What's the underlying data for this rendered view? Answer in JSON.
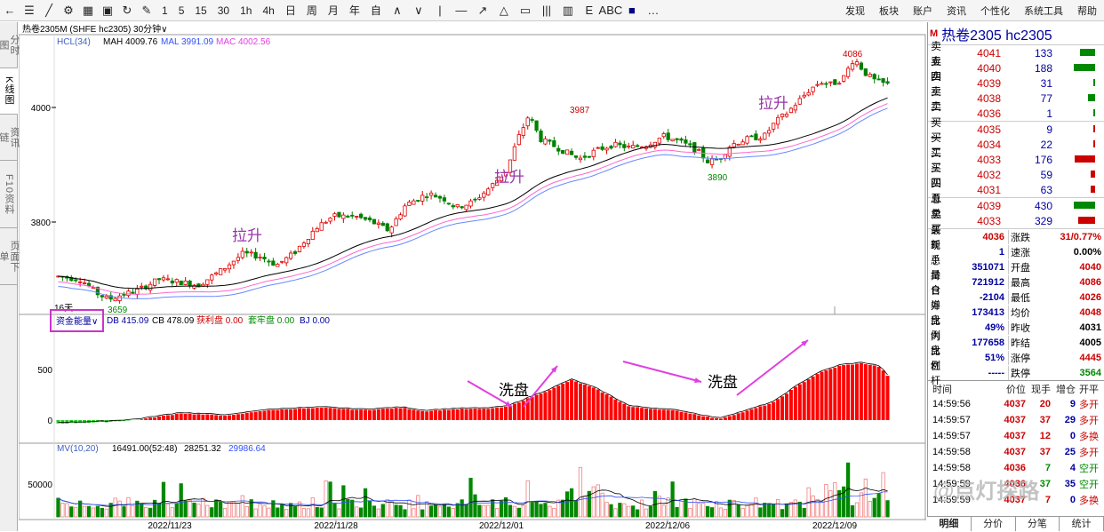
{
  "toolbar": {
    "icons": [
      "back-icon",
      "menu-icon",
      "line-icon",
      "settings-icon",
      "grid-icon",
      "save-icon",
      "refresh-icon",
      "draw-icon"
    ],
    "periods": [
      "1",
      "5",
      "15",
      "30",
      "1h",
      "4h",
      "日",
      "周",
      "月",
      "年",
      "自"
    ],
    "right_menu": [
      "发现",
      "板块",
      "账户",
      "资讯",
      "个性化",
      "系统工具",
      "帮助"
    ]
  },
  "left_tabs": [
    {
      "label": "分时图",
      "active": false
    },
    {
      "label": "K线图",
      "active": true
    },
    {
      "label": "资讯链",
      "active": false
    },
    {
      "label": "F10资料",
      "active": false
    },
    {
      "label": "页面下单",
      "active": false
    }
  ],
  "chart_title": "热卷2305",
  "chart_title_sup": "M",
  "chart_subtitle": "(SHFE hc2305)",
  "chart_period": "30分钟",
  "main_indicator": {
    "name": "HCL(34)",
    "mah": "MAH 4009.76",
    "mal": "MAL 3991.09",
    "mac": "MAC 4002.56"
  },
  "fund_indicator": {
    "name": "资金能量",
    "db": "DB 415.09",
    "cb": "CB 478.09",
    "profit": "获利盘 0.00",
    "trapped": "套牢盘 0.00",
    "bj": "BJ 0.00"
  },
  "mv_indicator": {
    "name": "MV(10,20)",
    "v1": "16491.00(52:48)",
    "v2": "28251.32",
    "v3": "29986.64"
  },
  "annotations": {
    "lift1": "拉升",
    "lift2": "拉升",
    "lift3": "拉升",
    "wash1": "洗盘",
    "wash2": "洗盘",
    "high1": "3987",
    "high2": "4086",
    "low1": "3659",
    "low2": "3890",
    "days": "16天"
  },
  "chart_data": {
    "type": "candlestick",
    "y_ticks": [
      "4000",
      "3800"
    ],
    "fund_ticks": [
      "500",
      "0"
    ],
    "mv_ticks": [
      "50000"
    ],
    "x_labels": [
      "2022/11/23",
      "2022/11/28",
      "2022/12/01",
      "2022/12/06",
      "2022/12/09"
    ]
  },
  "right_panel": {
    "title": "热卷2305  hc2305",
    "title_badge": "M",
    "asks": [
      {
        "label": "卖五",
        "price": "4041",
        "vol": "133",
        "bar": 0.7,
        "color": "#080"
      },
      {
        "label": "卖四",
        "price": "4040",
        "vol": "188",
        "bar": 1.0,
        "color": "#080"
      },
      {
        "label": "卖三",
        "price": "4039",
        "vol": "31",
        "bar": 0.08,
        "color": "#080"
      },
      {
        "label": "卖二",
        "price": "4038",
        "vol": "77",
        "bar": 0.35,
        "color": "#080"
      },
      {
        "label": "卖一",
        "price": "4036",
        "vol": "1",
        "bar": 0,
        "color": "#080"
      }
    ],
    "bids": [
      {
        "label": "买一",
        "price": "4035",
        "vol": "9",
        "bar": 0.04,
        "color": "#c00"
      },
      {
        "label": "买二",
        "price": "4034",
        "vol": "22",
        "bar": 0.04,
        "color": "#c00"
      },
      {
        "label": "买三",
        "price": "4033",
        "vol": "176",
        "bar": 0.95,
        "color": "#c00"
      },
      {
        "label": "买四",
        "price": "4032",
        "vol": "59",
        "bar": 0.2,
        "color": "#c00"
      },
      {
        "label": "买五",
        "price": "4031",
        "vol": "63",
        "bar": 0.22,
        "color": "#c00"
      }
    ],
    "totals": [
      {
        "label": "总卖",
        "price": "4039",
        "vol": "430",
        "bar": 1.0,
        "color": "#080"
      },
      {
        "label": "总买",
        "price": "4033",
        "vol": "329",
        "bar": 0.8,
        "color": "#c00"
      }
    ],
    "stats": [
      {
        "l": "最新",
        "v": "4036",
        "vc": "#c00",
        "l2": "涨跌",
        "v2": "31/0.77%",
        "v2c": "#c00"
      },
      {
        "l": "现手",
        "v": "1",
        "vc": "#0000a0",
        "l2": "速涨",
        "v2": "0.00%",
        "v2c": "#000"
      },
      {
        "l": "总量",
        "v": "351071",
        "vc": "#0000a0",
        "l2": "开盘",
        "v2": "4040",
        "v2c": "#c00"
      },
      {
        "l": "持仓",
        "v": "721912",
        "vc": "#0000a0",
        "l2": "最高",
        "v2": "4086",
        "v2c": "#c00"
      },
      {
        "l": "日增",
        "v": "-2104",
        "vc": "#0000a0",
        "l2": "最低",
        "v2": "4026",
        "v2c": "#c00"
      },
      {
        "l": "外盘",
        "v": "173413",
        "vc": "#0000a0",
        "l2": "均价",
        "v2": "4048",
        "v2c": "#c00"
      },
      {
        "l": "比例",
        "v": "49%",
        "vc": "#0000a0",
        "l2": "昨收",
        "v2": "4031",
        "v2c": "#000"
      },
      {
        "l": "内盘",
        "v": "177658",
        "vc": "#0000a0",
        "l2": "昨结",
        "v2": "4005",
        "v2c": "#000"
      },
      {
        "l": "比例",
        "v": "51%",
        "vc": "#0000a0",
        "l2": "涨停",
        "v2": "4445",
        "v2c": "#c00"
      },
      {
        "l": "杠杆",
        "v": "-----",
        "vc": "#0000a0",
        "l2": "跌停",
        "v2": "3564",
        "v2c": "#080"
      }
    ],
    "tick_head": {
      "time": "时间",
      "price": "价位",
      "hand": "现手",
      "inc": "增仓",
      "open": "开平"
    },
    "ticks": [
      {
        "time": "14:59:56",
        "price": "4037",
        "hand": "20",
        "inc": "9",
        "open": "多开",
        "oc": "#c00"
      },
      {
        "time": "14:59:57",
        "price": "4037",
        "hand": "37",
        "inc": "29",
        "open": "多开",
        "oc": "#c00"
      },
      {
        "time": "14:59:57",
        "price": "4037",
        "hand": "12",
        "inc": "0",
        "open": "多换",
        "oc": "#c00"
      },
      {
        "time": "14:59:58",
        "price": "4037",
        "hand": "37",
        "inc": "25",
        "open": "多开",
        "oc": "#c00"
      },
      {
        "time": "14:59:58",
        "price": "4036",
        "hand": "7",
        "inc": "4",
        "open": "空开",
        "oc": "#080"
      },
      {
        "time": "14:59:59",
        "price": "4036",
        "hand": "37",
        "inc": "35",
        "open": "空开",
        "oc": "#080"
      },
      {
        "time": "14:59:59",
        "price": "4037",
        "hand": "7",
        "inc": "0",
        "open": "多换",
        "oc": "#c00"
      }
    ],
    "bottom_tabs": [
      {
        "label": "明细",
        "active": true
      },
      {
        "label": "分价",
        "active": false
      },
      {
        "label": "分笔",
        "active": false
      },
      {
        "label": "统计",
        "active": false
      }
    ]
  },
  "watermark": "@点灯探路",
  "colors": {
    "up": "#e00000",
    "down": "#008000",
    "pink": "#ff66cc",
    "blue": "#6688ff",
    "black": "#000",
    "magenta": "#cc33cc"
  }
}
